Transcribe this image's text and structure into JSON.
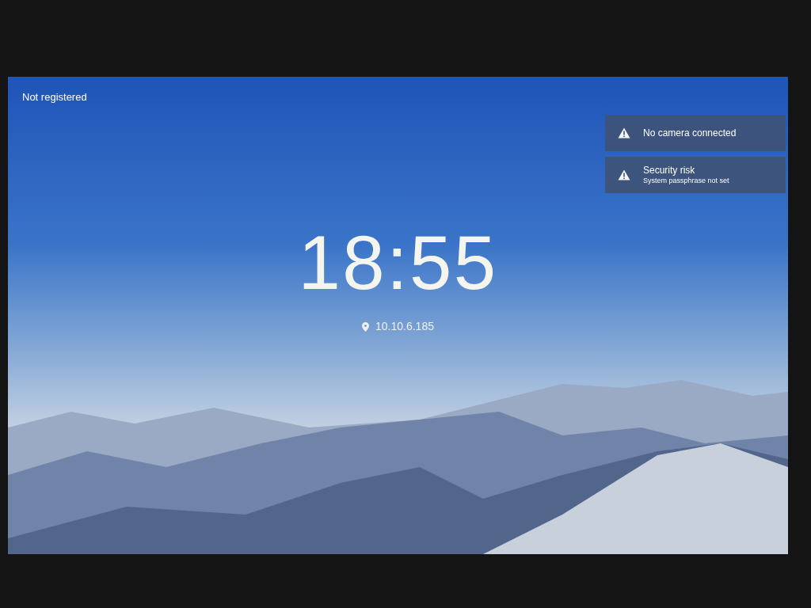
{
  "status": {
    "text": "Not registered"
  },
  "notifications": [
    {
      "kind": "warning",
      "title": "No camera connected"
    },
    {
      "kind": "warning",
      "title": "Security risk",
      "detail": "System passphrase not set"
    }
  ],
  "clock": {
    "time": "18:55"
  },
  "address": {
    "text": "10.10.6.185"
  }
}
